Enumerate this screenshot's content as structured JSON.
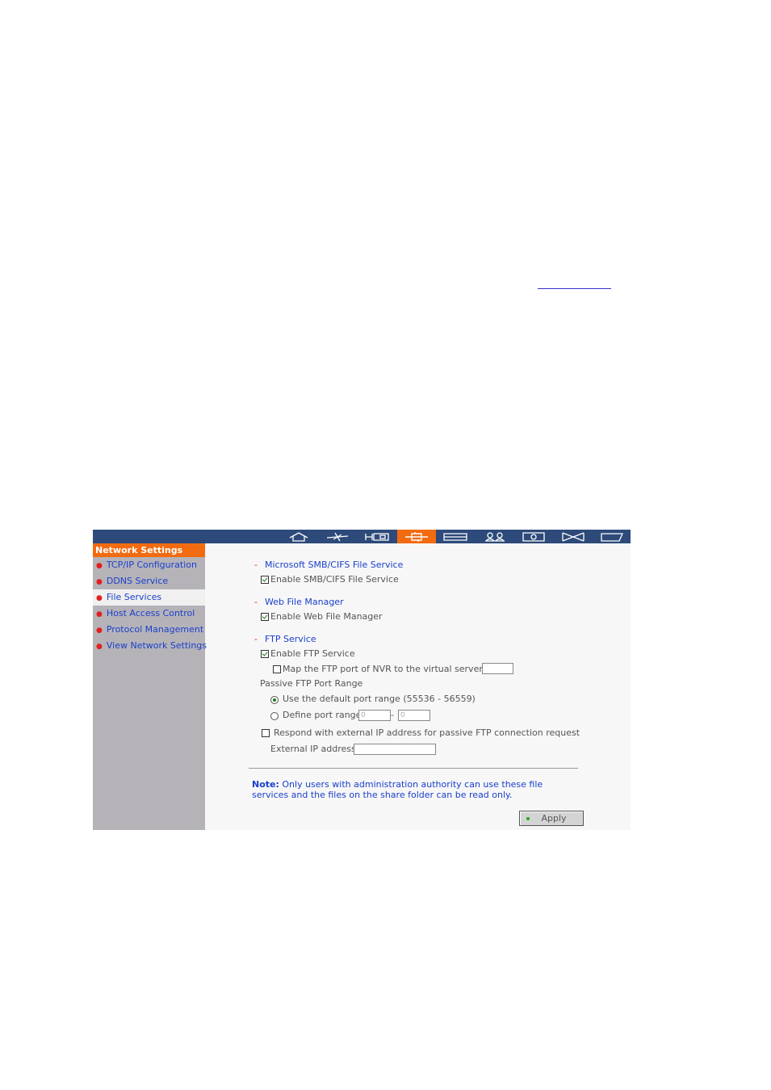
{
  "sidebar": {
    "title": "Network Settings",
    "items": [
      {
        "label": "TCP/IP Configuration"
      },
      {
        "label": "DDNS Service"
      },
      {
        "label": "File Services"
      },
      {
        "label": "Host Access Control"
      },
      {
        "label": "Protocol Management"
      },
      {
        "label": "View Network Settings"
      }
    ]
  },
  "topnav": {
    "icons": [
      "home-icon",
      "wizard-icon",
      "system-icon",
      "network-icon",
      "storage-icon",
      "users-icon",
      "camera-icon",
      "tools-icon",
      "logout-icon"
    ],
    "active_index": 3,
    "colors": {
      "bar": "#2d4a7a",
      "active": "#f26b10"
    }
  },
  "smb": {
    "dash": "-",
    "title": "Microsoft SMB/CIFS File Service",
    "enable_label": "Enable SMB/CIFS File Service",
    "enabled": true
  },
  "webfm": {
    "dash": "-",
    "title": "Web File Manager",
    "enable_label": "Enable Web File Manager",
    "enabled": true
  },
  "ftp": {
    "dash": "-",
    "title": "FTP Service",
    "enable_label": "Enable FTP Service",
    "enabled": true,
    "map_label": "Map the FTP port of NVR to the virtual server as",
    "map_checked": false,
    "map_value": "",
    "passive_label": "Passive FTP Port Range",
    "default_range_label": "Use the default port range (55536 - 56559)",
    "define_range_label": "Define port range:",
    "range_from": "0",
    "range_sep": "-",
    "range_to": "0",
    "respond_label": "Respond with external IP address for passive FTP connection request",
    "respond_checked": false,
    "external_ip_label": "External IP address:",
    "external_ip_value": ""
  },
  "note": {
    "label": "Note:",
    "text": " Only users with administration authority can use these file services and the files on the share folder can be read only."
  },
  "apply_label": "Apply"
}
